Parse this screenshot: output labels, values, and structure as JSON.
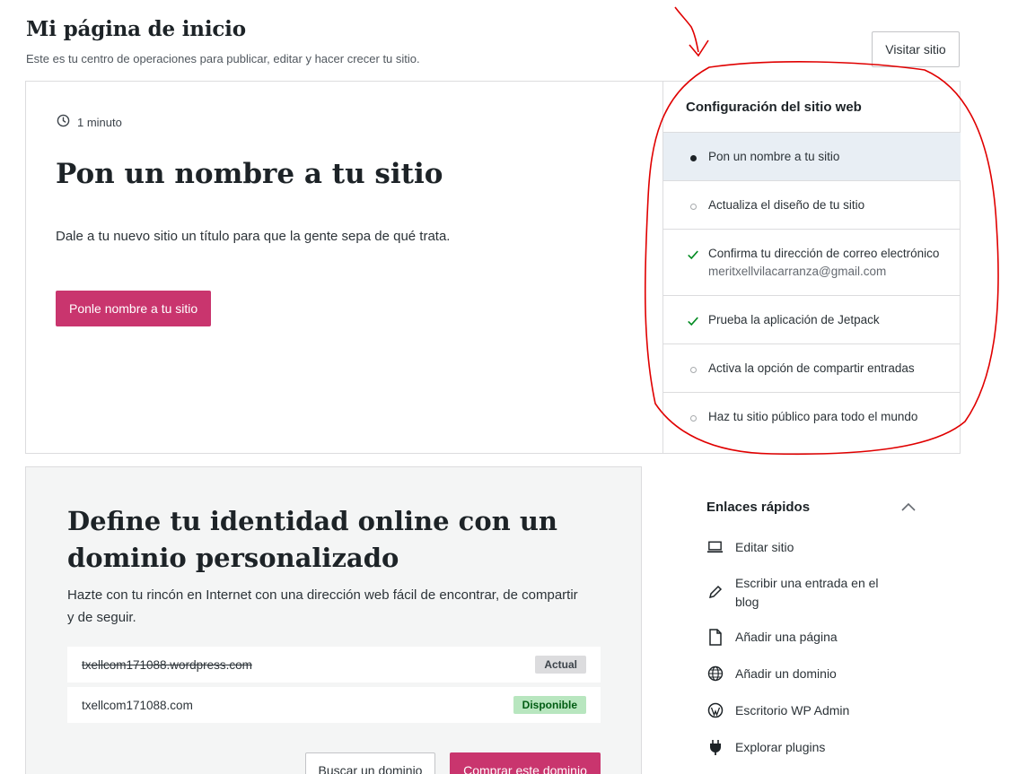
{
  "header": {
    "title": "Mi página de inicio",
    "subtitle": "Este es tu centro de operaciones para publicar, editar y hacer crecer tu sitio.",
    "visit_button": "Visitar sitio"
  },
  "task": {
    "time": "1 minuto",
    "title": "Pon un nombre a tu sitio",
    "description": "Dale a tu nuevo sitio un título para que la gente sepa de qué trata.",
    "cta": "Ponle nombre a tu sitio"
  },
  "checklist": {
    "title": "Configuración del sitio web",
    "items": [
      {
        "label": "Pon un nombre a tu sitio",
        "status": "current"
      },
      {
        "label": "Actualiza el diseño de tu sitio",
        "status": "pending"
      },
      {
        "label": "Confirma tu dirección de correo electrónico",
        "sub": "meritxellvilacarranza@gmail.com",
        "status": "done"
      },
      {
        "label": "Prueba la aplicación de Jetpack",
        "status": "done"
      },
      {
        "label": "Activa la opción de compartir entradas",
        "status": "pending"
      },
      {
        "label": "Haz tu sitio público para todo el mundo",
        "status": "pending"
      }
    ]
  },
  "domain": {
    "title": "Define tu identidad online con un dominio personalizado",
    "description": "Hazte con tu rincón en Internet con una dirección web fácil de encontrar, de compartir y de seguir.",
    "rows": [
      {
        "name": "txellcom171088.wordpress.com",
        "badge": "Actual"
      },
      {
        "name": "txellcom171088.com",
        "badge": "Disponible"
      }
    ],
    "search_button": "Buscar un dominio",
    "buy_button": "Comprar este dominio"
  },
  "quick_links": {
    "title": "Enlaces rápidos",
    "items": [
      {
        "label": "Editar sitio",
        "icon": "laptop-icon"
      },
      {
        "label": "Escribir una entrada en el blog",
        "icon": "pencil-icon"
      },
      {
        "label": "Añadir una página",
        "icon": "page-icon"
      },
      {
        "label": "Añadir un dominio",
        "icon": "globe-icon"
      },
      {
        "label": "Escritorio WP Admin",
        "icon": "wordpress-icon"
      },
      {
        "label": "Explorar plugins",
        "icon": "plug-icon"
      }
    ]
  },
  "colors": {
    "accent": "#c9356e",
    "check": "#008a20",
    "annotation": "#e00000"
  }
}
